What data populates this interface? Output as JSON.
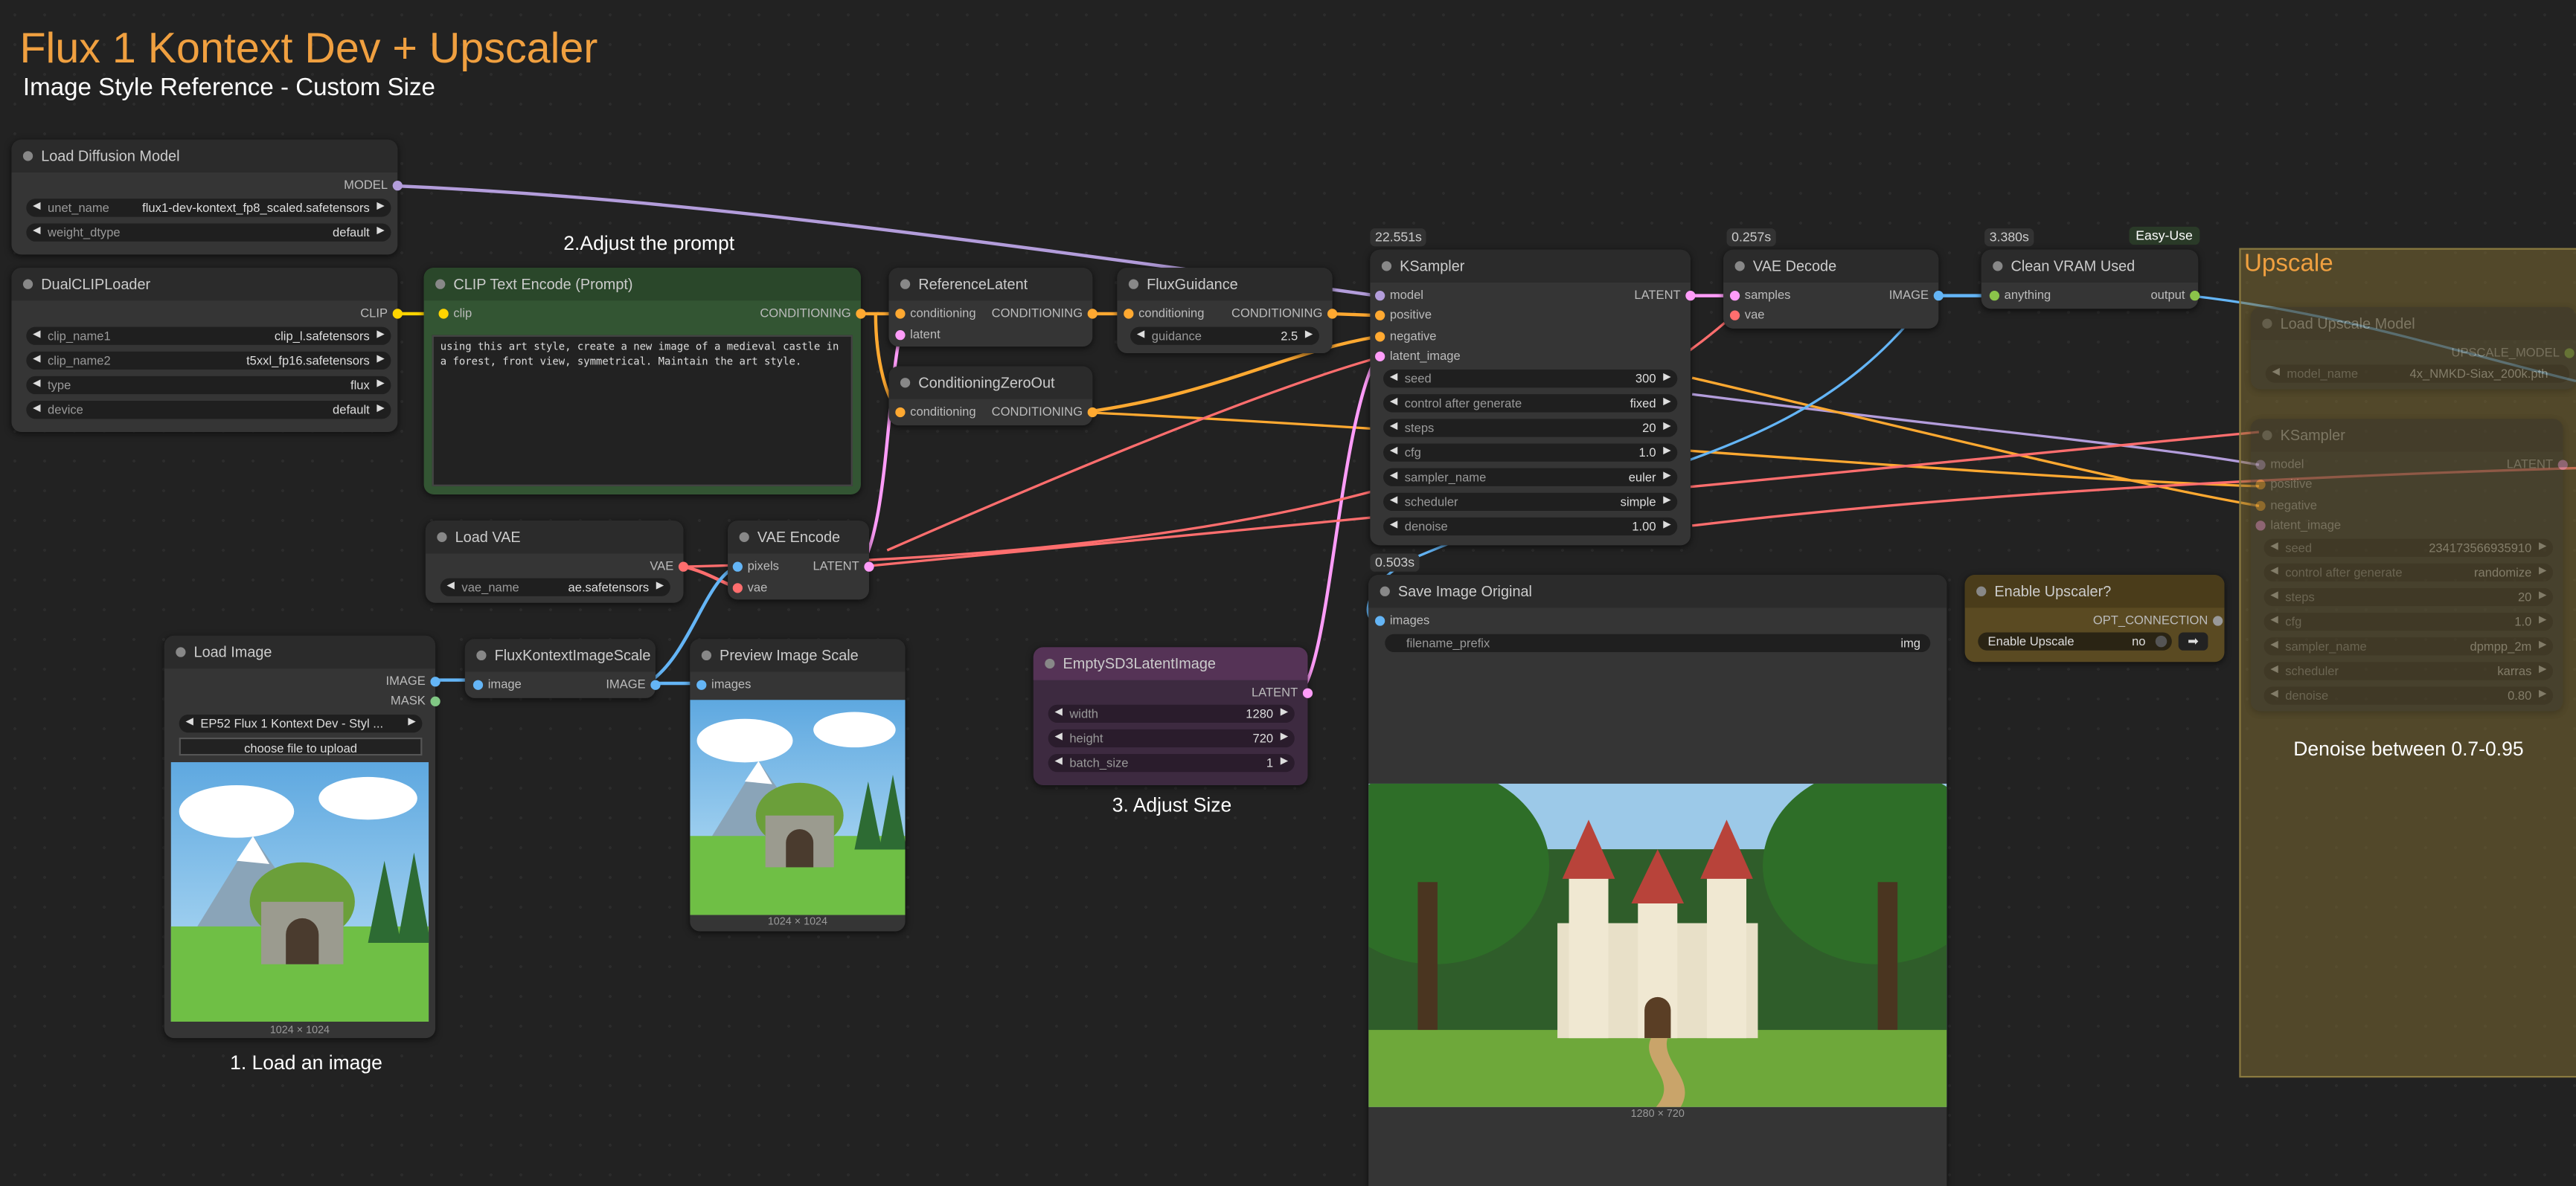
{
  "header": {
    "title": "Flux 1 Kontext Dev + Upscaler",
    "subtitle": "Image Style Reference - Custom Size"
  },
  "notes": {
    "adjust_prompt": "2.Adjust the prompt",
    "adjust_size": "3. Adjust Size",
    "load_image": "1. Load an image",
    "denoise": "Denoise between 0.7-0.95"
  },
  "colors": {
    "accent": "#f0a040",
    "model": "#b39ddb",
    "clip": "#ffd500",
    "conditioning": "#ffa931",
    "latent": "#ff9cf9",
    "image": "#64b5f6",
    "vae": "#ff6e6e"
  },
  "nodes": {
    "load_diffusion": {
      "title": "Load Diffusion Model",
      "out_model": "MODEL",
      "unet_label": "unet_name",
      "unet_value": "flux1-dev-kontext_fp8_scaled.safetensors",
      "dtype_label": "weight_dtype",
      "dtype_value": "default"
    },
    "dual_clip": {
      "title": "DualCLIPLoader",
      "out_clip": "CLIP",
      "clip1_label": "clip_name1",
      "clip1_value": "clip_l.safetensors",
      "clip2_label": "clip_name2",
      "clip2_value": "t5xxl_fp16.safetensors",
      "type_label": "type",
      "type_value": "flux",
      "device_label": "device",
      "device_value": "default"
    },
    "clip_text": {
      "title": "CLIP Text Encode (Prompt)",
      "in_clip": "clip",
      "out_cond": "CONDITIONING",
      "prompt": "using this art style, create a new image of a medieval castle in a forest, front view, symmetrical. Maintain the art style."
    },
    "ref_latent": {
      "title": "ReferenceLatent",
      "in_cond": "conditioning",
      "in_latent": "latent",
      "out_cond": "CONDITIONING"
    },
    "cond_zero": {
      "title": "ConditioningZeroOut",
      "in_cond": "conditioning",
      "out_cond": "CONDITIONING"
    },
    "flux_guidance": {
      "title": "FluxGuidance",
      "in_cond": "conditioning",
      "out_cond": "CONDITIONING",
      "guidance_label": "guidance",
      "guidance_value": "2.5"
    },
    "ksampler": {
      "time": "22.551s",
      "title": "KSampler",
      "in_model": "model",
      "in_positive": "positive",
      "in_negative": "negative",
      "in_latent": "latent_image",
      "out_latent": "LATENT",
      "widgets": [
        {
          "label": "seed",
          "value": "300"
        },
        {
          "label": "control after generate",
          "value": "fixed"
        },
        {
          "label": "steps",
          "value": "20"
        },
        {
          "label": "cfg",
          "value": "1.0"
        },
        {
          "label": "sampler_name",
          "value": "euler"
        },
        {
          "label": "scheduler",
          "value": "simple"
        },
        {
          "label": "denoise",
          "value": "1.00"
        }
      ]
    },
    "vae_decode": {
      "time": "0.257s",
      "title": "VAE Decode",
      "in_samples": "samples",
      "in_vae": "vae",
      "out_image": "IMAGE"
    },
    "clean_vram": {
      "time": "3.380s",
      "badge": "Easy-Use",
      "title": "Clean VRAM Used",
      "in_anything": "anything",
      "out_output": "output"
    },
    "load_vae": {
      "title": "Load VAE",
      "out_vae": "VAE",
      "vae_label": "vae_name",
      "vae_value": "ae.safetensors"
    },
    "vae_encode": {
      "title": "VAE Encode",
      "in_pixels": "pixels",
      "in_vae": "vae",
      "out_latent": "LATENT"
    },
    "load_image": {
      "title": "Load Image",
      "out_image": "IMAGE",
      "out_mask": "MASK",
      "file_value": "EP52 Flux 1 Kontext Dev - Styl ...",
      "upload_label": "choose file to upload",
      "caption": "1024 × 1024"
    },
    "kontext_scale": {
      "title": "FluxKontextImageScale",
      "in_image": "image",
      "out_image": "IMAGE"
    },
    "preview_scale": {
      "title": "Preview Image Scale",
      "in_images": "images",
      "caption": "1024 × 1024"
    },
    "empty_latent": {
      "title": "EmptySD3LatentImage",
      "out_latent": "LATENT",
      "width_label": "width",
      "width_value": "1280",
      "height_label": "height",
      "height_value": "720",
      "batch_label": "batch_size",
      "batch_value": "1"
    },
    "save_image": {
      "time": "0.503s",
      "title": "Save Image Original",
      "in_images": "images",
      "prefix_label": "filename_prefix",
      "prefix_value": "img",
      "caption": "1280 × 720"
    },
    "enable_upscaler": {
      "title": "Enable Upscaler?",
      "out_opt": "OPT_CONNECTION",
      "toggle_label": "Enable Upscale",
      "toggle_value": "no"
    },
    "upscale_group": {
      "title": "Upscale"
    },
    "load_upscale": {
      "title": "Load Upscale Model",
      "out_model": "UPSCALE_MODEL",
      "model_label": "model_name",
      "model_value": "4x_NMKD-Siax_200k.pth"
    },
    "ksampler2": {
      "title": "KSampler",
      "in_model": "model",
      "in_positive": "positive",
      "in_negative": "negative",
      "in_latent": "latent_image",
      "out_latent": "LATENT",
      "widgets": [
        {
          "label": "seed",
          "value": "234173566935910"
        },
        {
          "label": "control after generate",
          "value": "randomize"
        },
        {
          "label": "steps",
          "value": "20"
        },
        {
          "label": "cfg",
          "value": "1.0"
        },
        {
          "label": "sampler_name",
          "value": "dpmpp_2m"
        },
        {
          "label": "scheduler",
          "value": "karras"
        },
        {
          "label": "denoise",
          "value": "0.80"
        }
      ]
    }
  }
}
